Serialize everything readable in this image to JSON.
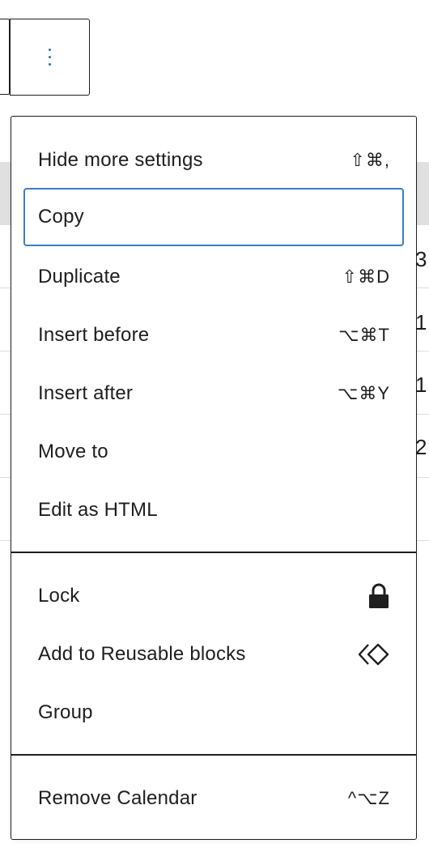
{
  "toolbar": {
    "options_icon": "vertical-ellipsis-icon"
  },
  "background": {
    "column_digits": [
      "3",
      "1",
      "1",
      "2"
    ]
  },
  "menu": {
    "group1": [
      {
        "label": "Hide more settings",
        "shortcut": "⇧⌘,"
      },
      {
        "label": "Copy",
        "shortcut": ""
      },
      {
        "label": "Duplicate",
        "shortcut": "⇧⌘D"
      },
      {
        "label": "Insert before",
        "shortcut": "⌥⌘T"
      },
      {
        "label": "Insert after",
        "shortcut": "⌥⌘Y"
      },
      {
        "label": "Move to",
        "shortcut": ""
      },
      {
        "label": "Edit as HTML",
        "shortcut": ""
      }
    ],
    "group2": [
      {
        "label": "Lock",
        "icon": "lock-icon"
      },
      {
        "label": "Add to Reusable blocks",
        "icon": "reusable-block-icon"
      },
      {
        "label": "Group",
        "icon": ""
      }
    ],
    "group3": [
      {
        "label": "Remove Calendar",
        "shortcut": "^⌥Z"
      }
    ]
  },
  "colors": {
    "focus_ring": "#3582c4",
    "options_dots": "#2271b1",
    "text": "#1e1e1e",
    "header_band": "#e0e0e0"
  }
}
